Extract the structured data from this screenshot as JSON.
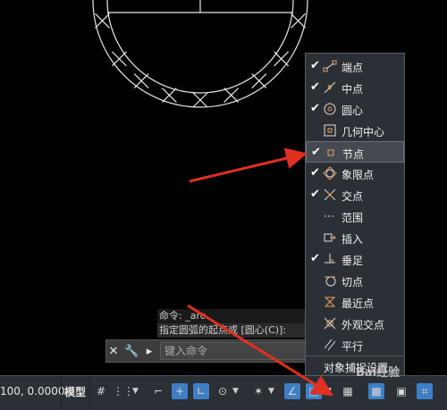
{
  "history": {
    "line1": "命令: _arc",
    "line2": "指定圆弧的起点或 [圆心(C)]:"
  },
  "command_bar": {
    "close_icon": "close-icon",
    "customize_icon": "wrench-icon",
    "prompt_icon": "command-prompt-icon",
    "placeholder": "键入命令"
  },
  "status_bar": {
    "coordinates": "100, 0.0000",
    "model_label": "模型"
  },
  "snap_menu": {
    "items": [
      {
        "label": "端点",
        "checked": true,
        "icon": "endpoint-icon"
      },
      {
        "label": "中点",
        "checked": true,
        "icon": "midpoint-icon"
      },
      {
        "label": "圆心",
        "checked": true,
        "icon": "center-icon"
      },
      {
        "label": "几何中心",
        "checked": false,
        "icon": "geometric-center-icon"
      },
      {
        "label": "节点",
        "checked": true,
        "icon": "node-icon",
        "highlighted": true
      },
      {
        "label": "象限点",
        "checked": true,
        "icon": "quadrant-icon"
      },
      {
        "label": "交点",
        "checked": true,
        "icon": "intersection-icon"
      },
      {
        "label": "范围",
        "checked": false,
        "icon": "extension-icon"
      },
      {
        "label": "插入",
        "checked": false,
        "icon": "insertion-icon"
      },
      {
        "label": "垂足",
        "checked": true,
        "icon": "perpendicular-icon"
      },
      {
        "label": "切点",
        "checked": false,
        "icon": "tangent-icon"
      },
      {
        "label": "最近点",
        "checked": false,
        "icon": "nearest-icon"
      },
      {
        "label": "外观交点",
        "checked": false,
        "icon": "apparent-intersection-icon"
      },
      {
        "label": "平行",
        "checked": false,
        "icon": "parallel-icon"
      }
    ],
    "footer": "对象捕捉设置..."
  },
  "watermark": "Bai经验",
  "colors": {
    "accent": "#3f7fc4",
    "arrow": "#e03020",
    "menu_bg": "#2b2f36",
    "icon": "#e8a060"
  }
}
